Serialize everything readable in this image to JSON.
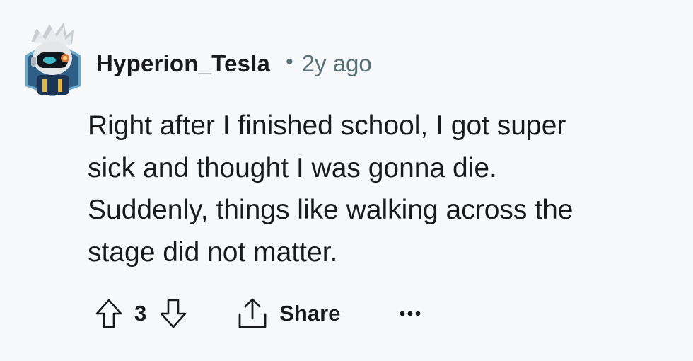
{
  "comment": {
    "username": "Hyperion_Tesla",
    "separator": "•",
    "timestamp": "2y ago",
    "body": [
      "Right after I finished school, I got super",
      "sick and thought I was gonna die.",
      "Suddenly, things like walking across the",
      "stage did not matter."
    ]
  },
  "actions": {
    "upvote_icon": "arrow-up-outline-icon",
    "score": "3",
    "downvote_icon": "arrow-down-outline-icon",
    "share_icon": "share-upload-icon",
    "share_label": "Share",
    "more_icon": "ellipsis-icon"
  },
  "colors": {
    "background": "#f7f8fa",
    "text_primary": "#1a1a1b",
    "text_secondary": "#576f76",
    "avatar_bg": "#3a6a8f",
    "avatar_accent": "#3fb9c7"
  }
}
